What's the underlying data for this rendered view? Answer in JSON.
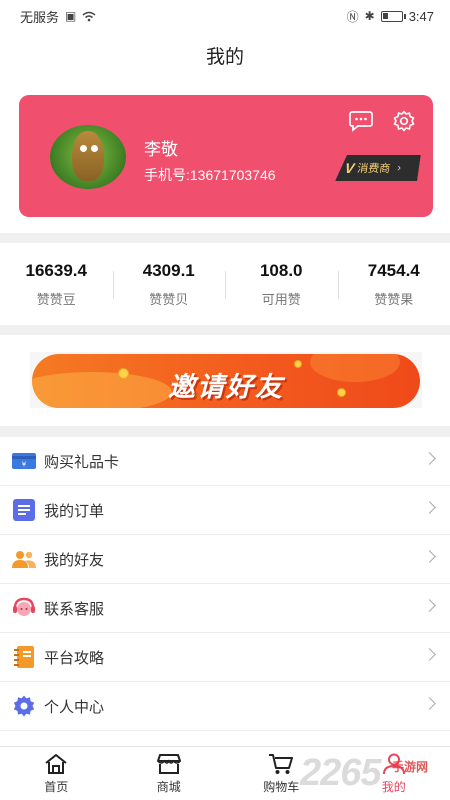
{
  "status_bar": {
    "carrier": "无服务",
    "time": "3:47",
    "battery_level": 0.3
  },
  "header": {
    "title": "我的"
  },
  "profile": {
    "name": "李敬",
    "phone": "手机号:13671703746",
    "vip_label": "消费商",
    "vip_letter": "V"
  },
  "stats": [
    {
      "value": "16639.4",
      "label": "赞赞豆"
    },
    {
      "value": "4309.1",
      "label": "赞赞贝"
    },
    {
      "value": "108.0",
      "label": "可用赞"
    },
    {
      "value": "7454.4",
      "label": "赞赞果"
    }
  ],
  "banner": {
    "text": "邀请好友"
  },
  "menu": [
    {
      "label": "购买礼品卡",
      "icon": "gift-card-icon",
      "color": "#3a7ae0"
    },
    {
      "label": "我的订单",
      "icon": "order-list-icon",
      "color": "#5b6ee8"
    },
    {
      "label": "我的好友",
      "icon": "friends-icon",
      "color": "#f39a2b"
    },
    {
      "label": "联系客服",
      "icon": "customer-service-icon",
      "color": "#e8455f"
    },
    {
      "label": "平台攻略",
      "icon": "guide-book-icon",
      "color": "#f39a2b"
    },
    {
      "label": "个人中心",
      "icon": "settings-gear-icon",
      "color": "#5b6ee8"
    }
  ],
  "bottom_nav": [
    {
      "label": "首页",
      "icon": "home-icon"
    },
    {
      "label": "商城",
      "icon": "store-icon"
    },
    {
      "label": "购物车",
      "icon": "cart-icon"
    },
    {
      "label": "我的",
      "icon": "profile-icon",
      "active": true
    }
  ],
  "colors": {
    "accent": "#e8455f",
    "card": "#f0506e",
    "banner": "#f35b1e"
  },
  "watermark": {
    "text": "2265",
    "sub": "手游网"
  }
}
